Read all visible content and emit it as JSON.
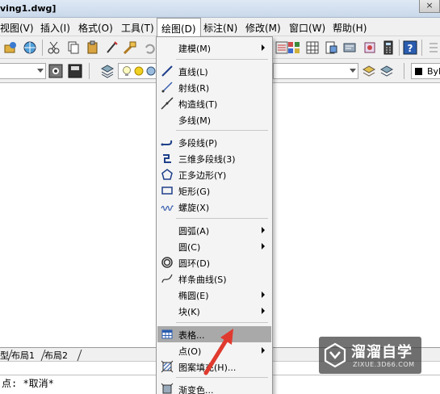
{
  "window": {
    "title": "ving1.dwg]",
    "close_glyph": "×"
  },
  "menubar": {
    "items": [
      {
        "label": "视图(V)"
      },
      {
        "label": "插入(I)"
      },
      {
        "label": "格式(O)"
      },
      {
        "label": "工具(T)"
      },
      {
        "label": "绘图(D)"
      },
      {
        "label": "标注(N)"
      },
      {
        "label": "修改(M)"
      },
      {
        "label": "窗口(W)"
      },
      {
        "label": "帮助(H)"
      }
    ]
  },
  "toolbar2": {
    "lineweight_value": "ByL"
  },
  "draw_menu": {
    "items": [
      {
        "label": "建模(M)",
        "icon": "none",
        "submenu": true
      },
      {
        "label": "直线(L)",
        "icon": "line-icon",
        "submenu": false
      },
      {
        "label": "射线(R)",
        "icon": "ray-icon",
        "submenu": false
      },
      {
        "label": "构造线(T)",
        "icon": "construction-line-icon",
        "submenu": false
      },
      {
        "label": "多线(M)",
        "icon": "none",
        "submenu": false
      },
      {
        "label": "多段线(P)",
        "icon": "polyline-icon",
        "submenu": false
      },
      {
        "label": "三维多段线(3)",
        "icon": "3d-polyline-icon",
        "submenu": false
      },
      {
        "label": "正多边形(Y)",
        "icon": "polygon-icon",
        "submenu": false
      },
      {
        "label": "矩形(G)",
        "icon": "rectangle-icon",
        "submenu": false
      },
      {
        "label": "螺旋(X)",
        "icon": "helix-icon",
        "submenu": false
      },
      {
        "label": "圆弧(A)",
        "icon": "none",
        "submenu": true
      },
      {
        "label": "圆(C)",
        "icon": "none",
        "submenu": true
      },
      {
        "label": "圆环(D)",
        "icon": "donut-icon",
        "submenu": false
      },
      {
        "label": "样条曲线(S)",
        "icon": "spline-icon",
        "submenu": false
      },
      {
        "label": "椭圆(E)",
        "icon": "none",
        "submenu": true
      },
      {
        "label": "块(K)",
        "icon": "none",
        "submenu": true
      },
      {
        "label": "表格...",
        "icon": "table-icon",
        "submenu": false,
        "highlighted": true
      },
      {
        "label": "点(O)",
        "icon": "none",
        "submenu": true
      },
      {
        "label": "图案填充(H)...",
        "icon": "hatch-icon",
        "submenu": false
      },
      {
        "label": "渐变色...",
        "icon": "gradient-icon",
        "submenu": false
      }
    ]
  },
  "layout_tabs": {
    "tab_model": "型",
    "tab_layout1": "布局1",
    "tab_layout2": "布局2"
  },
  "command_line": {
    "text": "点: *取消*"
  },
  "watermark": {
    "name": "溜溜自学",
    "url": "ZIXUE.3D66.COM"
  },
  "colors": {
    "menu_highlight": "#a9a9a9",
    "annotation_arrow": "#e03a2f"
  }
}
